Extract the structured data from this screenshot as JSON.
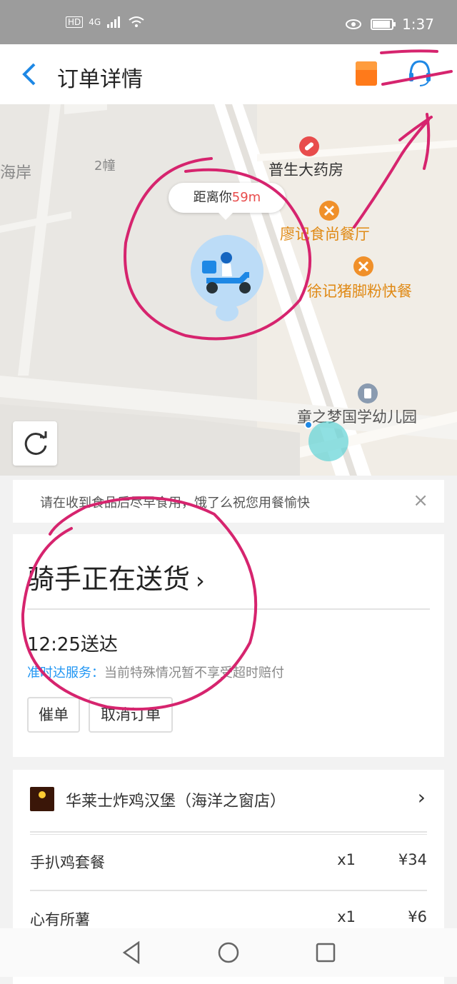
{
  "status_bar": {
    "network": "4G",
    "hd": "HD",
    "time": "1:37"
  },
  "header": {
    "back_icon": "chevron-left-icon",
    "title": "订单详情",
    "red_packet_icon": "red-packet-icon",
    "service_icon": "headset-icon"
  },
  "map": {
    "building_label": "2幢",
    "edge_label": "海岸",
    "pharmacy": "普生大药房",
    "restaurant_1": "廖记食尚餐厅",
    "restaurant_2": "徐记猪脚粉快餐",
    "kindergarten": "童之梦国学幼儿园",
    "distance_prefix": "距离你",
    "distance_value": "59m",
    "refresh_icon": "refresh-icon"
  },
  "notice": {
    "text": "请在收到食品后尽早食用，饿了么祝您用餐愉快",
    "close": "×"
  },
  "delivery": {
    "status": "骑手正在送货",
    "chevron": "›",
    "eta": "12:25送达",
    "ontime_label": "准时达服务：",
    "ontime_text": "当前特殊情况暂不享受超时赔付",
    "urge_button": "催单",
    "cancel_button": "取消订单"
  },
  "order": {
    "shop_name": "华莱士炸鸡汉堡（海洋之窗店）",
    "chevron": "›",
    "items": [
      {
        "name": "手扒鸡套餐",
        "qty": "x1",
        "price": "¥34"
      },
      {
        "name": "心有所薯",
        "qty": "x1",
        "price": "¥6"
      }
    ]
  },
  "colors": {
    "accent": "#1e88e5",
    "orange": "#e08a16",
    "annotation": "#d6246e"
  }
}
